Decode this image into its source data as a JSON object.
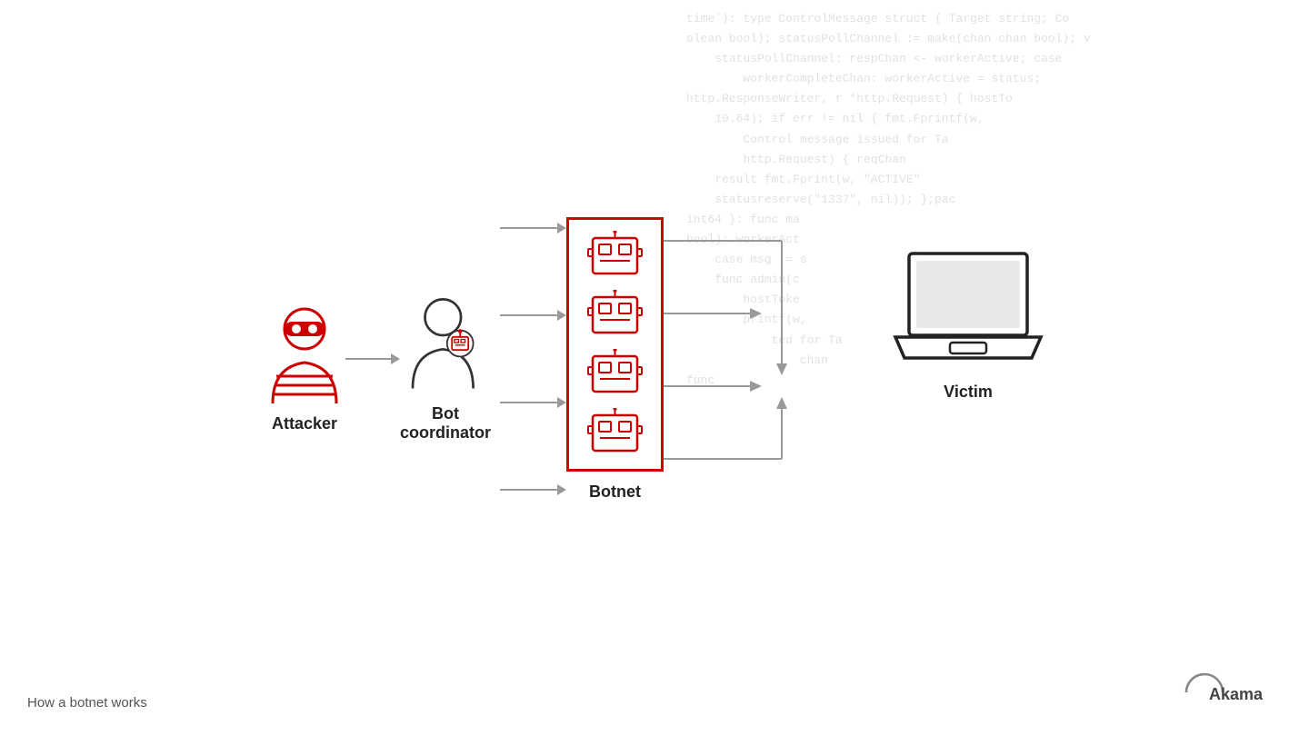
{
  "code_bg": {
    "lines": [
      "time`): type ControlMessage struct { Target string; Co",
      "olean bool); statusPollChannel := make(chan chan bool); v",
      "statusPollChannel: respChan <- workerActive; case",
      "workerCompleteChan: workerActive = status;",
      "http.ResponseWriter, r *http.Request) { hostTo",
      "10.64); if err != nil { fmt.Fprintf(w,",
      "Control message issued for Ta",
      "http.Request) { reqChan",
      "result fmt.Fprint(w, \"ACTIVE\"",
      "statusreserve(\"1337\", nil)); };pac",
      "int64 }: func ma",
      "bool): workerAct",
      "case msg := s",
      "func admin(c",
      "hostToke",
      "printf(w,",
      "ted for Ta",
      "chan",
      "func"
    ]
  },
  "labels": {
    "attacker": "Attacker",
    "bot_coordinator": "Bot\ncoordinator",
    "botnet": "Botnet",
    "victim": "Victim",
    "caption": "How a botnet works",
    "issued_partial": "Issued for Ta"
  },
  "colors": {
    "red": "#cc0000",
    "arrow": "#999999",
    "text_dark": "#222222",
    "text_muted": "#555555"
  },
  "akamai": {
    "logo_text": "Akamai"
  }
}
